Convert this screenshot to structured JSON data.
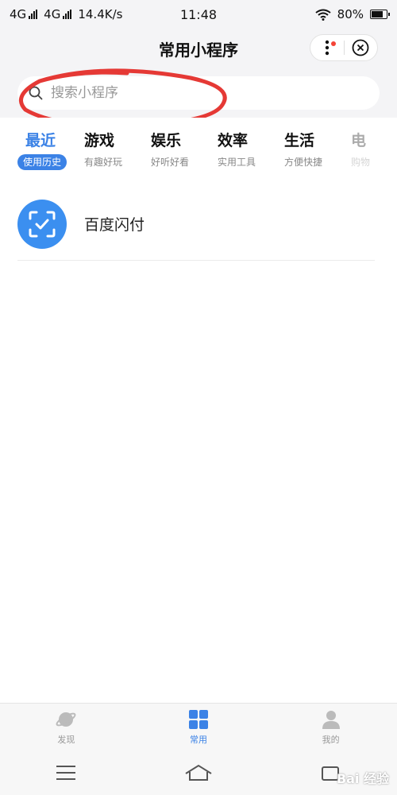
{
  "status_bar": {
    "network1": "4G",
    "network2": "4G",
    "speed": "14.4K/s",
    "time": "11:48",
    "battery": "80%"
  },
  "header": {
    "title": "常用小程序"
  },
  "search": {
    "placeholder": "搜索小程序"
  },
  "tabs": [
    {
      "name": "最近",
      "sub": "使用历史"
    },
    {
      "name": "游戏",
      "sub": "有趣好玩"
    },
    {
      "name": "娱乐",
      "sub": "好听好看"
    },
    {
      "name": "效率",
      "sub": "实用工具"
    },
    {
      "name": "生活",
      "sub": "方便快捷"
    },
    {
      "name": "电",
      "sub": "购物"
    }
  ],
  "apps": [
    {
      "name": "百度闪付"
    }
  ],
  "bottom_nav": [
    {
      "label": "发现"
    },
    {
      "label": "常用"
    },
    {
      "label": "我的"
    }
  ],
  "watermark": "Bai 经验",
  "colors": {
    "accent": "#3b82e6",
    "annotation": "#e53935",
    "app_icon": "#3b8ff0"
  }
}
